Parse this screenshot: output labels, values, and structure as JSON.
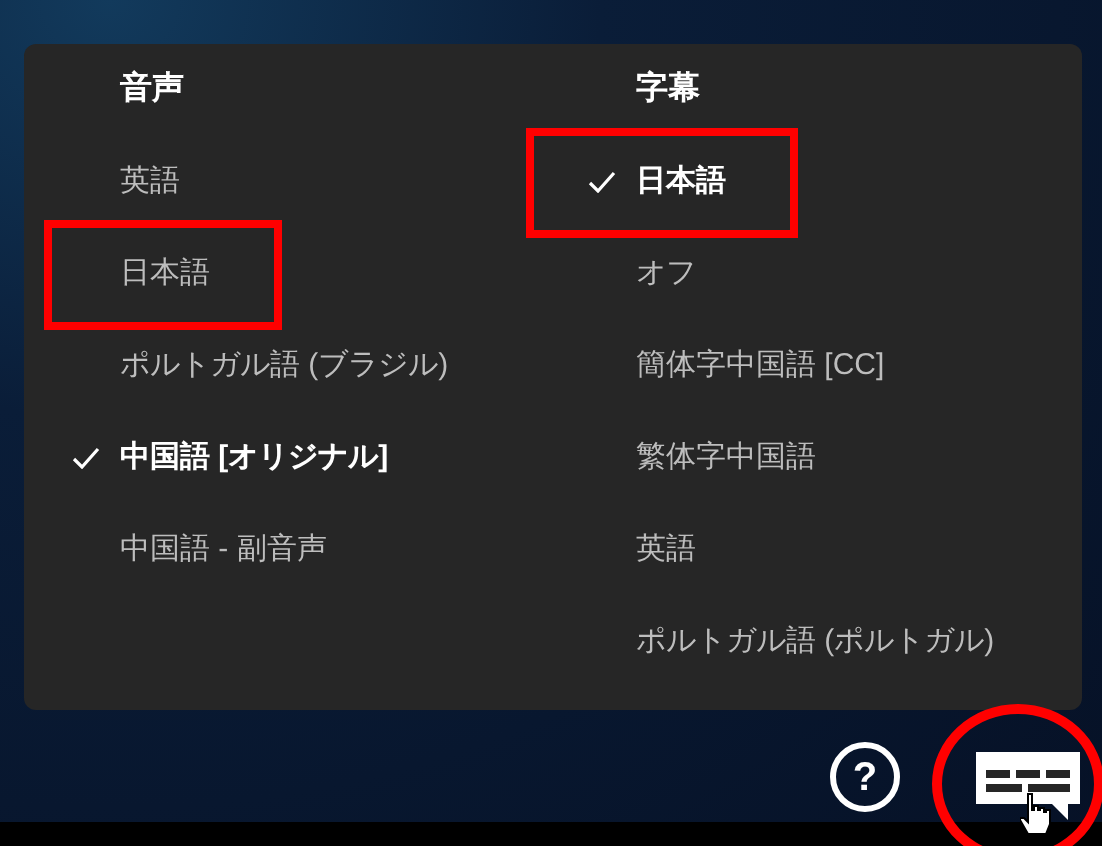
{
  "audio": {
    "heading": "音声",
    "options": [
      {
        "label": "英語",
        "selected": false,
        "highlighted": false
      },
      {
        "label": "日本語",
        "selected": false,
        "highlighted": true
      },
      {
        "label": "ポルトガル語 (ブラジル)",
        "selected": false,
        "highlighted": false
      },
      {
        "label": "中国語 [オリジナル]",
        "selected": true,
        "highlighted": false
      },
      {
        "label": "中国語 - 副音声",
        "selected": false,
        "highlighted": false
      }
    ]
  },
  "subtitles": {
    "heading": "字幕",
    "options": [
      {
        "label": "日本語",
        "selected": true,
        "highlighted": true
      },
      {
        "label": "オフ",
        "selected": false,
        "highlighted": false
      },
      {
        "label": "簡体字中国語 [CC]",
        "selected": false,
        "highlighted": false
      },
      {
        "label": "繁体字中国語",
        "selected": false,
        "highlighted": false
      },
      {
        "label": "英語",
        "selected": false,
        "highlighted": false
      },
      {
        "label": "ポルトガル語 (ポルトガル)",
        "selected": false,
        "highlighted": false
      }
    ]
  },
  "controls": {
    "help_button": {
      "label": "?"
    },
    "subtitles_button": {
      "highlighted": true
    }
  }
}
